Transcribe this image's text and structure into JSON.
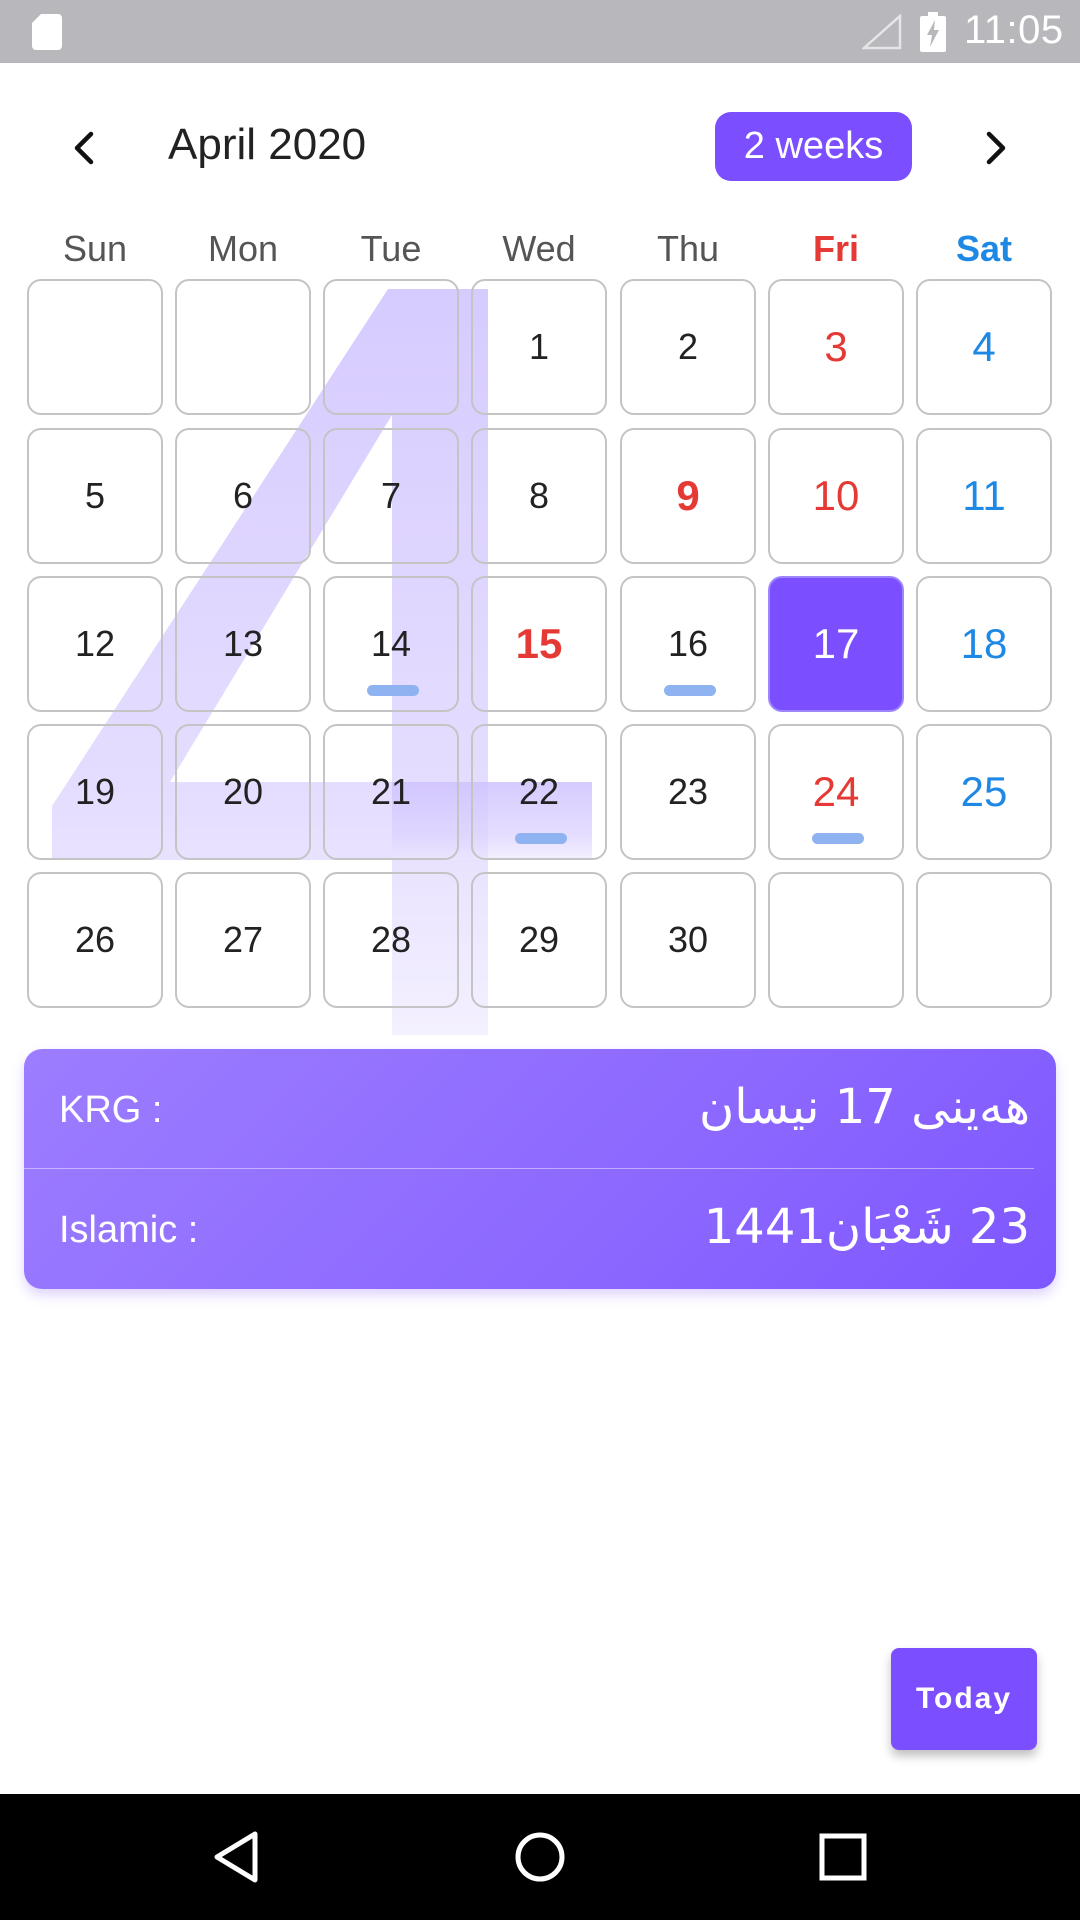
{
  "status_bar": {
    "time": "11:05",
    "icons": [
      "sd-card-icon",
      "signal-icon",
      "battery-charging-icon"
    ]
  },
  "header": {
    "title": "April 2020",
    "view_toggle_label": "2 weeks",
    "prev_icon": "chevron-left-icon",
    "next_icon": "chevron-right-icon"
  },
  "weekdays": [
    "Sun",
    "Mon",
    "Tue",
    "Wed",
    "Thu",
    "Fri",
    "Sat"
  ],
  "calendar": {
    "background_numeral": "4",
    "selected_day": "17",
    "weeks": [
      [
        "",
        "",
        "",
        "1",
        "2",
        "3",
        "4"
      ],
      [
        "5",
        "6",
        "7",
        "8",
        "9",
        "10",
        "11"
      ],
      [
        "12",
        "13",
        "14",
        "15",
        "16",
        "17",
        "18"
      ],
      [
        "19",
        "20",
        "21",
        "22",
        "23",
        "24",
        "25"
      ],
      [
        "26",
        "27",
        "28",
        "29",
        "30",
        "",
        ""
      ]
    ],
    "event_days": [
      "14",
      "16",
      "22",
      "24"
    ],
    "red_days": [
      "3",
      "10",
      "24"
    ],
    "holiday_days": [
      "9",
      "15"
    ],
    "blue_days": [
      "4",
      "11",
      "18",
      "25"
    ]
  },
  "info_card": {
    "krg_label": "KRG :",
    "krg_value": "هەینی 17 نیسان",
    "islamic_label": "Islamic :",
    "islamic_value": "23 شَعْبَان1441"
  },
  "today_button": {
    "label": "Today"
  },
  "nav_bar": {
    "icons": [
      "back-icon",
      "home-icon",
      "recents-icon"
    ]
  },
  "colors": {
    "accent": "#7b4fff",
    "friday_red": "#e53935",
    "saturday_blue": "#1e88e5",
    "event_dot": "#8fb3f0",
    "status_bar": "#b8b7bb"
  }
}
